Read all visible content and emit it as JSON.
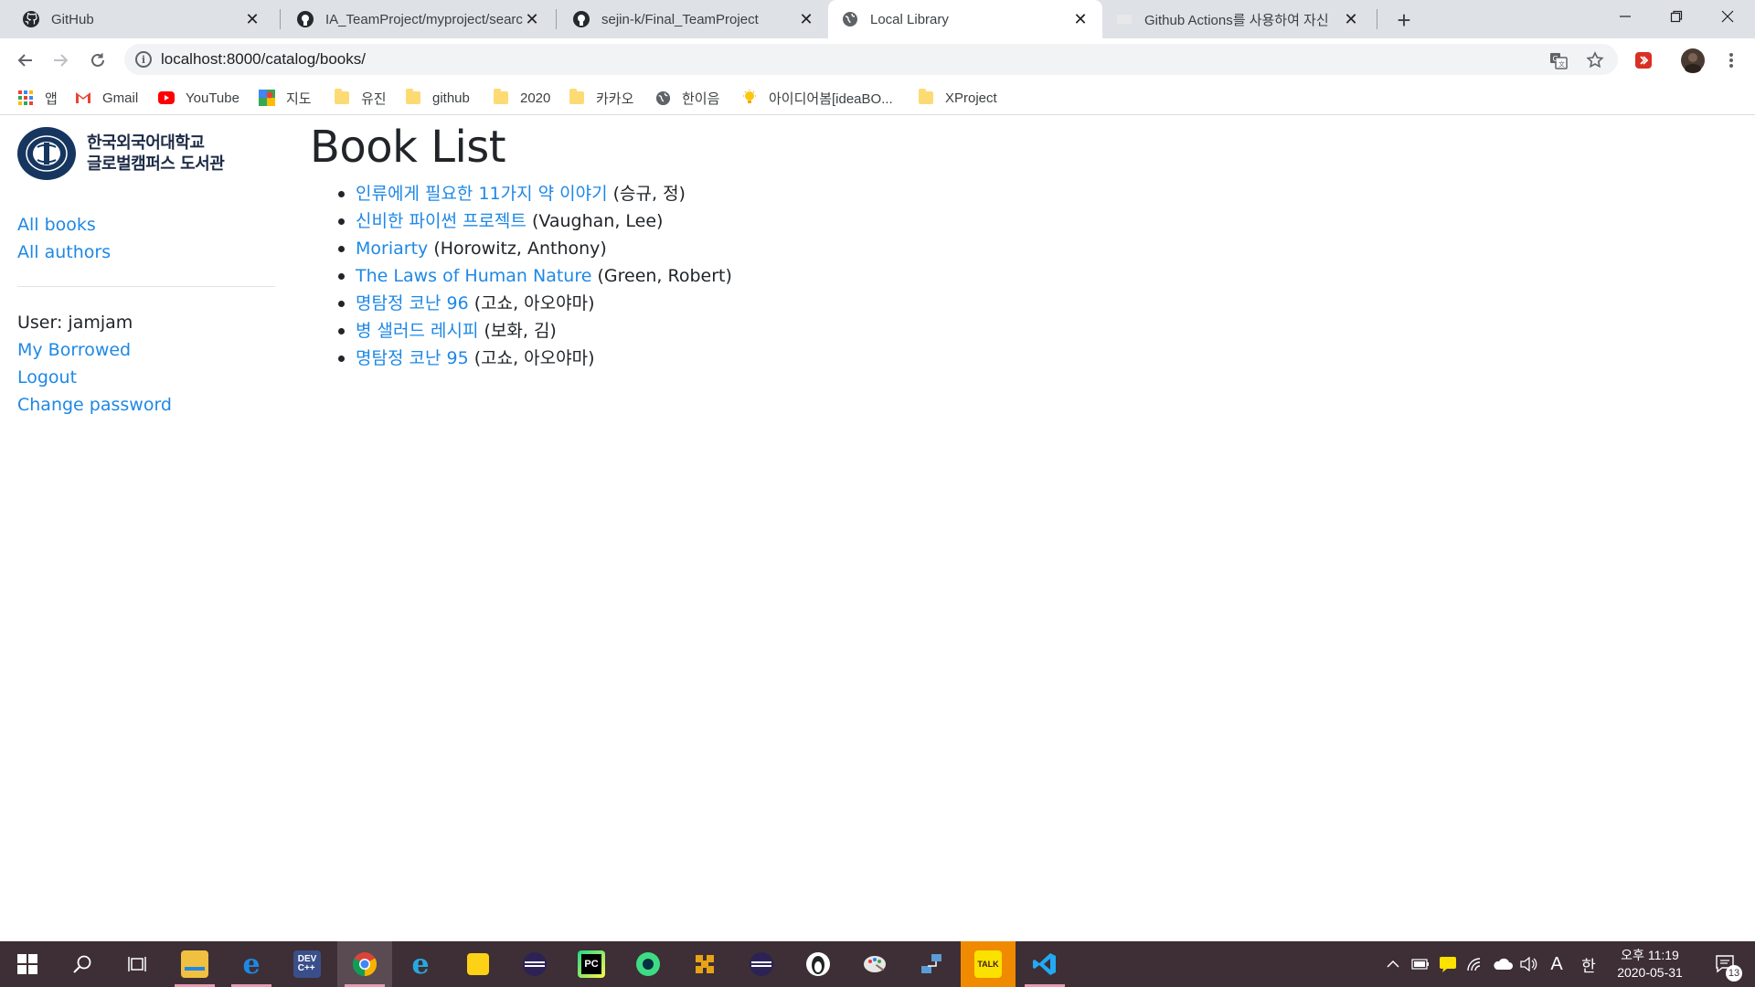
{
  "browser": {
    "tabs": [
      {
        "title": "GitHub",
        "icon": "github-icon"
      },
      {
        "title": "IA_TeamProject/myproject/search",
        "icon": "github-icon"
      },
      {
        "title": "sejin-k/Final_TeamProject",
        "icon": "github-icon"
      },
      {
        "title": "Local Library",
        "icon": "globe-icon"
      },
      {
        "title": "Github Actions를 사용하여 자신",
        "icon": "faded-site-icon"
      }
    ],
    "url": "localhost:8000/catalog/books/"
  },
  "bookmarks": [
    {
      "label": "앱",
      "icon": "apps-grid-icon"
    },
    {
      "label": "Gmail",
      "icon": "gmail-icon"
    },
    {
      "label": "YouTube",
      "icon": "youtube-icon"
    },
    {
      "label": "지도",
      "icon": "maps-icon"
    },
    {
      "label": "유진",
      "icon": "folder-icon"
    },
    {
      "label": "github",
      "icon": "folder-icon"
    },
    {
      "label": "2020",
      "icon": "folder-icon"
    },
    {
      "label": "카카오",
      "icon": "folder-icon"
    },
    {
      "label": "한이음",
      "icon": "globe-icon"
    },
    {
      "label": "아이디어봄[ideaBO...",
      "icon": "lightbulb-icon"
    },
    {
      "label": "XProject",
      "icon": "folder-icon"
    }
  ],
  "page": {
    "logo_line1": "한국외국어대학교",
    "logo_line2": "글로벌캠퍼스 도서관",
    "nav": {
      "all_books": "All books",
      "all_authors": "All authors"
    },
    "user_label": "User: jamjam",
    "user_links": {
      "my_borrowed": "My Borrowed",
      "logout": "Logout",
      "change_password": "Change password"
    },
    "title": "Book List",
    "books": [
      {
        "title": "인류에게 필요한 11가지 약 이야기",
        "author": "(승규, 정)"
      },
      {
        "title": "신비한 파이썬 프로젝트",
        "author": "(Vaughan, Lee)"
      },
      {
        "title": "Moriarty",
        "author": "(Horowitz, Anthony)"
      },
      {
        "title": "The Laws of Human Nature",
        "author": "(Green, Robert)"
      },
      {
        "title": "명탐정 코난 96",
        "author": "(고쇼, 아오야마)"
      },
      {
        "title": "병 샐러드 레시피",
        "author": "(보화, 김)"
      },
      {
        "title": "명탐정 코난 95",
        "author": "(고쇼, 아오야마)"
      }
    ]
  },
  "taskbar": {
    "clock_time": "오후 11:19",
    "clock_date": "2020-05-31",
    "ime_lang": "A",
    "ime_mode": "한",
    "notification_count": "13"
  },
  "colors": {
    "link": "#1e88e5",
    "tabstrip": "#dee1e6",
    "taskbar": "#3d2f35"
  }
}
